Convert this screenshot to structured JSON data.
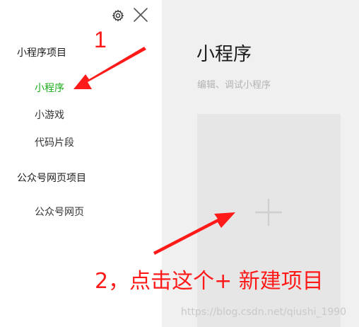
{
  "sidebar": {
    "group_miniprogram": "小程序项目",
    "items_miniprogram": [
      "小程序",
      "小游戏",
      "代码片段"
    ],
    "group_official": "公众号网页项目",
    "items_official": [
      "公众号网页"
    ],
    "active_item": "小程序"
  },
  "main": {
    "title": "小程序",
    "subtitle": "编辑、调试小程序"
  },
  "annotations": {
    "step1": "1",
    "step2": "2，点击这个+ 新建项目"
  },
  "watermark": "https://blog.csdn.net/qiushi_1990",
  "colors": {
    "active_green": "#1aad19",
    "annotation_red": "#ff1a1a",
    "main_bg": "#f0f0f1",
    "card_bg": "#e6e6e6"
  },
  "icons": {
    "settings": "gear-icon",
    "close": "close-icon",
    "create": "plus-icon"
  }
}
